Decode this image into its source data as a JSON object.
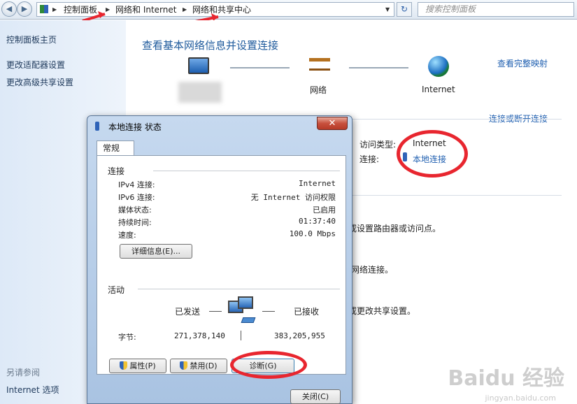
{
  "address_bar": {
    "crumbs": [
      "控制面板",
      "网络和 Internet",
      "网络和共享中心"
    ],
    "search_placeholder": "搜索控制面板"
  },
  "sidebar": {
    "top_links": [
      "控制面板主页",
      "更改适配器设置",
      "更改高级共享设置"
    ],
    "see_also": "另请参阅",
    "bottom_links": [
      "Internet 选项"
    ]
  },
  "main": {
    "title": "查看基本网络信息并设置连接",
    "view_full_map": "查看完整映射",
    "network_label": "网络",
    "internet_label": "Internet",
    "connect_disconnect": "连接或断开连接",
    "access_type_label": "访问类型:",
    "access_type_value": "Internet",
    "connection_label": "连接:",
    "connection_value": "本地连接",
    "fragments": [
      "或设置路由器或访问点。",
      "网络连接。",
      "或更改共享设置。"
    ]
  },
  "dialog": {
    "title": "本地连接 状态",
    "close_glyph": "✕",
    "tab": "常规",
    "connection_group": "连接",
    "rows": [
      {
        "label": "IPv4 连接:",
        "value": "Internet"
      },
      {
        "label": "IPv6 连接:",
        "value": "无 Internet 访问权限"
      },
      {
        "label": "媒体状态:",
        "value": "已启用"
      },
      {
        "label": "持续时间:",
        "value": "01:37:40"
      },
      {
        "label": "速度:",
        "value": "100.0 Mbps"
      }
    ],
    "details_button": "详细信息(E)...",
    "activity_group": "活动",
    "sent_label": "已发送",
    "received_label": "已接收",
    "bytes_label": "字节:",
    "bytes_sent": "271,378,140",
    "bytes_received": "383,205,955",
    "properties_button": "属性(P)",
    "disable_button": "禁用(D)",
    "diagnose_button": "诊断(G)",
    "close_button": "关闭(C)"
  },
  "watermark": {
    "brand": "Baidu 经验",
    "url": "jingyan.baidu.com"
  },
  "colors": {
    "link": "#1f5fb0",
    "annotation_red": "#e8262f"
  }
}
